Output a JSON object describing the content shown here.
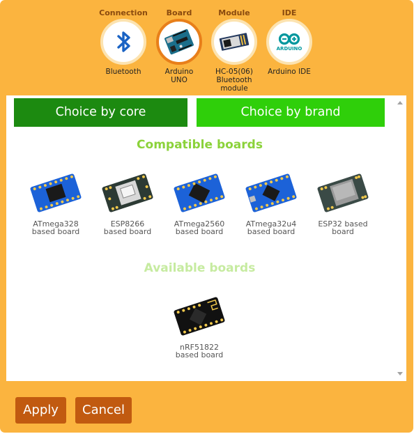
{
  "steps": [
    {
      "title": "Connection",
      "label": "Bluetooth",
      "icon": "bluetooth-icon"
    },
    {
      "title": "Board",
      "label": "Arduino\nUNO",
      "icon": "arduino-uno-board-icon"
    },
    {
      "title": "Module",
      "label": "HC-05(06)\nBluetooth\nmodule",
      "icon": "hc05-module-icon"
    },
    {
      "title": "IDE",
      "label": "Arduino IDE",
      "icon": "arduino-ide-logo-icon",
      "logo_text": "ARDUINO"
    }
  ],
  "active_step": "Board",
  "tabs": {
    "core": "Choice by core",
    "brand": "Choice by brand"
  },
  "sections": {
    "compatible": "Compatible boards",
    "available": "Available boards"
  },
  "compatible_boards": [
    {
      "line1": "ATmega328",
      "line2": "based board",
      "icon": "blue-board-icon"
    },
    {
      "line1": "ESP8266",
      "line2": "based board",
      "icon": "esp8266-board-icon"
    },
    {
      "line1": "ATmega2560",
      "line2": "based board",
      "icon": "blue-board-icon"
    },
    {
      "line1": "ATmega32u4",
      "line2": "based board",
      "icon": "blue-board-icon"
    },
    {
      "line1": "ESP32 based",
      "line2": "board",
      "icon": "esp32-board-icon"
    }
  ],
  "available_boards": [
    {
      "line1": "nRF51822",
      "line2": "based board",
      "icon": "nrf51822-board-icon"
    }
  ],
  "buttons": {
    "apply": "Apply",
    "cancel": "Cancel"
  },
  "colors": {
    "dialog_bg": "#fbb43f",
    "tab_core": "#1c8a10",
    "tab_brand": "#2fcf0a",
    "heading_compatible": "#8bd23a",
    "heading_available": "#c6eba0",
    "button": "#c15a10",
    "active_ring": "#e87f1a"
  }
}
